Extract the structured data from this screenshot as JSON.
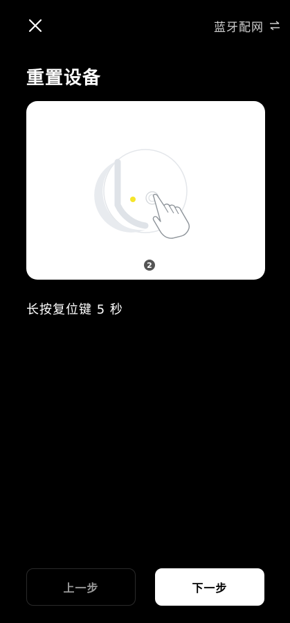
{
  "header": {
    "close_icon": "close-icon",
    "mode_label": "蓝牙配网",
    "mode_icon": "swap-arrows-icon"
  },
  "main": {
    "title": "重置设备",
    "illustration": {
      "step_badge": "2",
      "indicator_color": "#f5e52a"
    },
    "instruction": "长按复位键 5 秒"
  },
  "footer": {
    "prev_label": "上一步",
    "next_label": "下一步"
  },
  "colors": {
    "background": "#000000",
    "card": "#ffffff",
    "primary_button": "#ffffff"
  }
}
